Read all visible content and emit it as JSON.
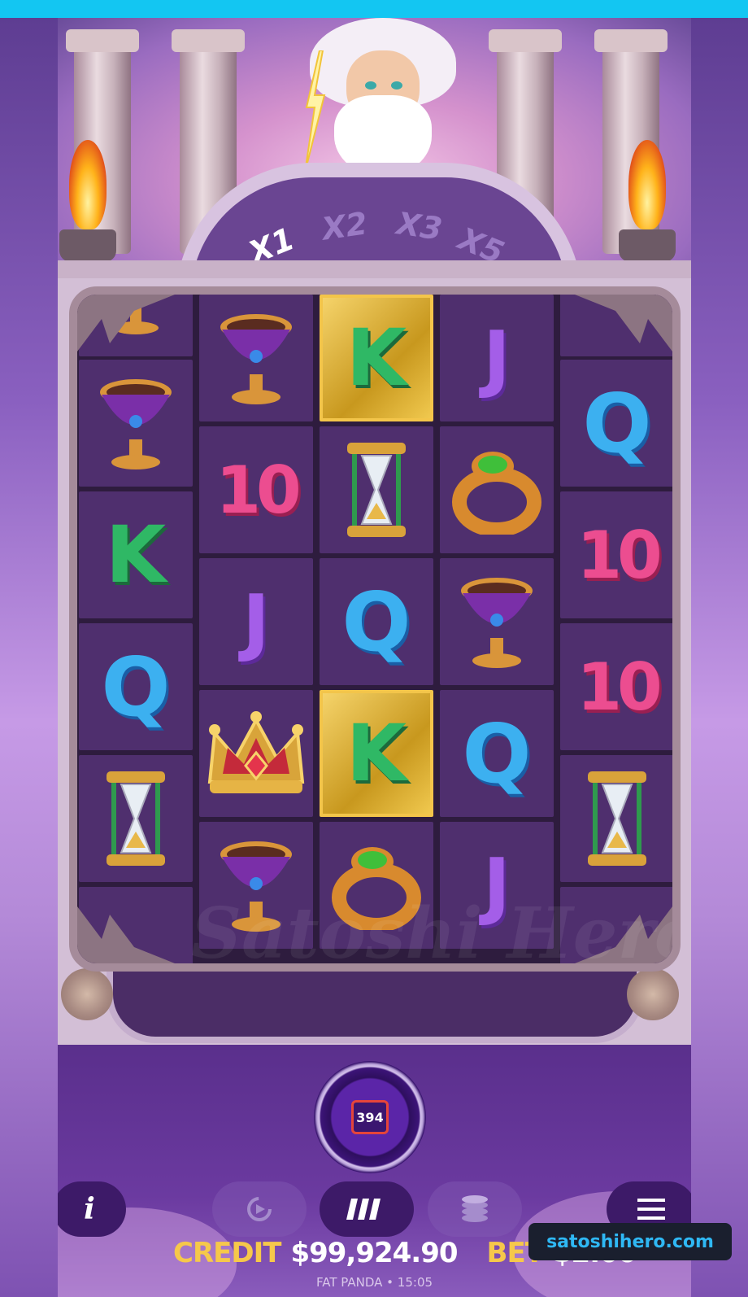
{
  "multipliers": [
    {
      "label": "X1",
      "active": true
    },
    {
      "label": "X2",
      "active": false
    },
    {
      "label": "X3",
      "active": false
    },
    {
      "label": "X5",
      "active": false
    }
  ],
  "grid": {
    "columns": 5,
    "symbols": [
      [
        "partial",
        "goblet",
        "goblet",
        "K",
        "Q",
        "hourglass",
        "partial"
      ],
      [
        "goblet",
        "10",
        "J",
        "crown",
        "goblet"
      ],
      [
        "K-gold",
        "hourglass",
        "Q",
        "K-gold",
        "ring"
      ],
      [
        "J",
        "ring",
        "goblet",
        "Q",
        "J"
      ],
      [
        "partial",
        "Q",
        "10",
        "10",
        "hourglass",
        "partial"
      ]
    ]
  },
  "spin": {
    "counter": "394"
  },
  "controls": {
    "info_label": "i",
    "auto_icon": "autoplay-icon",
    "turbo_icon": "turbo-icon",
    "coins_icon": "coins-icon",
    "menu_icon": "menu-icon"
  },
  "balance": {
    "credit_label": "CREDIT",
    "credit_value": "$99,924.90",
    "bet_label": "BET",
    "bet_value": "$2.00"
  },
  "footer": {
    "provider": "FAT PANDA",
    "time": "15:05",
    "separator": "•"
  },
  "overlay": {
    "site": "satoshihero.com",
    "watermark": "Satoshi Hero"
  },
  "colors": {
    "accent": "#f6c84a",
    "top_strip": "#13c6f2"
  }
}
